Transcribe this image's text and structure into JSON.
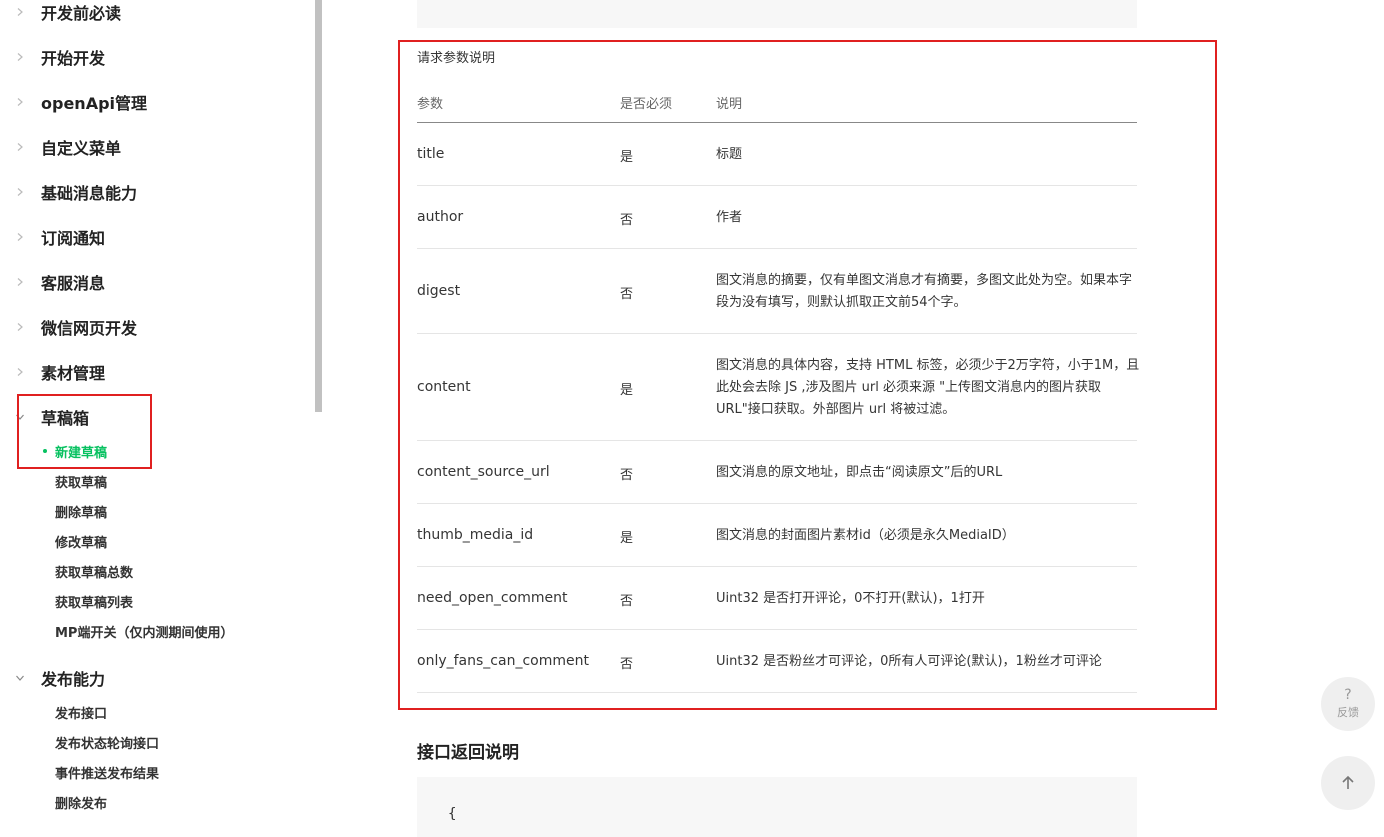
{
  "sidebar": {
    "menu": [
      {
        "label": "开发前必读",
        "expanded": false
      },
      {
        "label": "开始开发",
        "expanded": false
      },
      {
        "label": "openApi管理",
        "expanded": false
      },
      {
        "label": "自定义菜单",
        "expanded": false
      },
      {
        "label": "基础消息能力",
        "expanded": false
      },
      {
        "label": "订阅通知",
        "expanded": false
      },
      {
        "label": "客服消息",
        "expanded": false
      },
      {
        "label": "微信网页开发",
        "expanded": false
      },
      {
        "label": "素材管理",
        "expanded": false
      },
      {
        "label": "草稿箱",
        "expanded": true
      },
      {
        "label": "发布能力",
        "expanded": true
      }
    ],
    "draft_sub": [
      "新建草稿",
      "获取草稿",
      "删除草稿",
      "修改草稿",
      "获取草稿总数",
      "获取草稿列表",
      "MP端开关（仅内测期间使用）"
    ],
    "draft_active": "新建草稿",
    "publish_sub": [
      "发布接口",
      "发布状态轮询接口",
      "事件推送发布结果",
      "删除发布"
    ]
  },
  "main": {
    "request_caption": "请求参数说明",
    "table": {
      "headers": [
        "参数",
        "是否必须",
        "说明"
      ],
      "rows": [
        {
          "param": "title",
          "required": "是",
          "desc": "标题"
        },
        {
          "param": "author",
          "required": "否",
          "desc": "作者"
        },
        {
          "param": "digest",
          "required": "否",
          "desc": "图文消息的摘要，仅有单图文消息才有摘要，多图文此处为空。如果本字段为没有填写，则默认抓取正文前54个字。"
        },
        {
          "param": "content",
          "required": "是",
          "desc": "图文消息的具体内容，支持 HTML 标签，必须少于2万字符，小于1M，且此处会去除 JS ,涉及图片 url 必须来源 \"上传图文消息内的图片获取URL\"接口获取。外部图片 url 将被过滤。"
        },
        {
          "param": "content_source_url",
          "required": "否",
          "desc": "图文消息的原文地址，即点击“阅读原文”后的URL"
        },
        {
          "param": "thumb_media_id",
          "required": "是",
          "desc": "图文消息的封面图片素材id（必须是永久MediaID）"
        },
        {
          "param": "need_open_comment",
          "required": "否",
          "desc": "Uint32 是否打开评论，0不打开(默认)，1打开"
        },
        {
          "param": "only_fans_can_comment",
          "required": "否",
          "desc": "Uint32 是否粉丝才可评论，0所有人可评论(默认)，1粉丝才可评论"
        }
      ]
    },
    "return_heading": "接口返回说明",
    "code_start": "{"
  },
  "float": {
    "feedback_symbol": "?",
    "feedback_label": "反馈",
    "top_icon": "arrow-up-icon"
  },
  "colors": {
    "accent": "#07c160",
    "highlight": "#e02020"
  }
}
